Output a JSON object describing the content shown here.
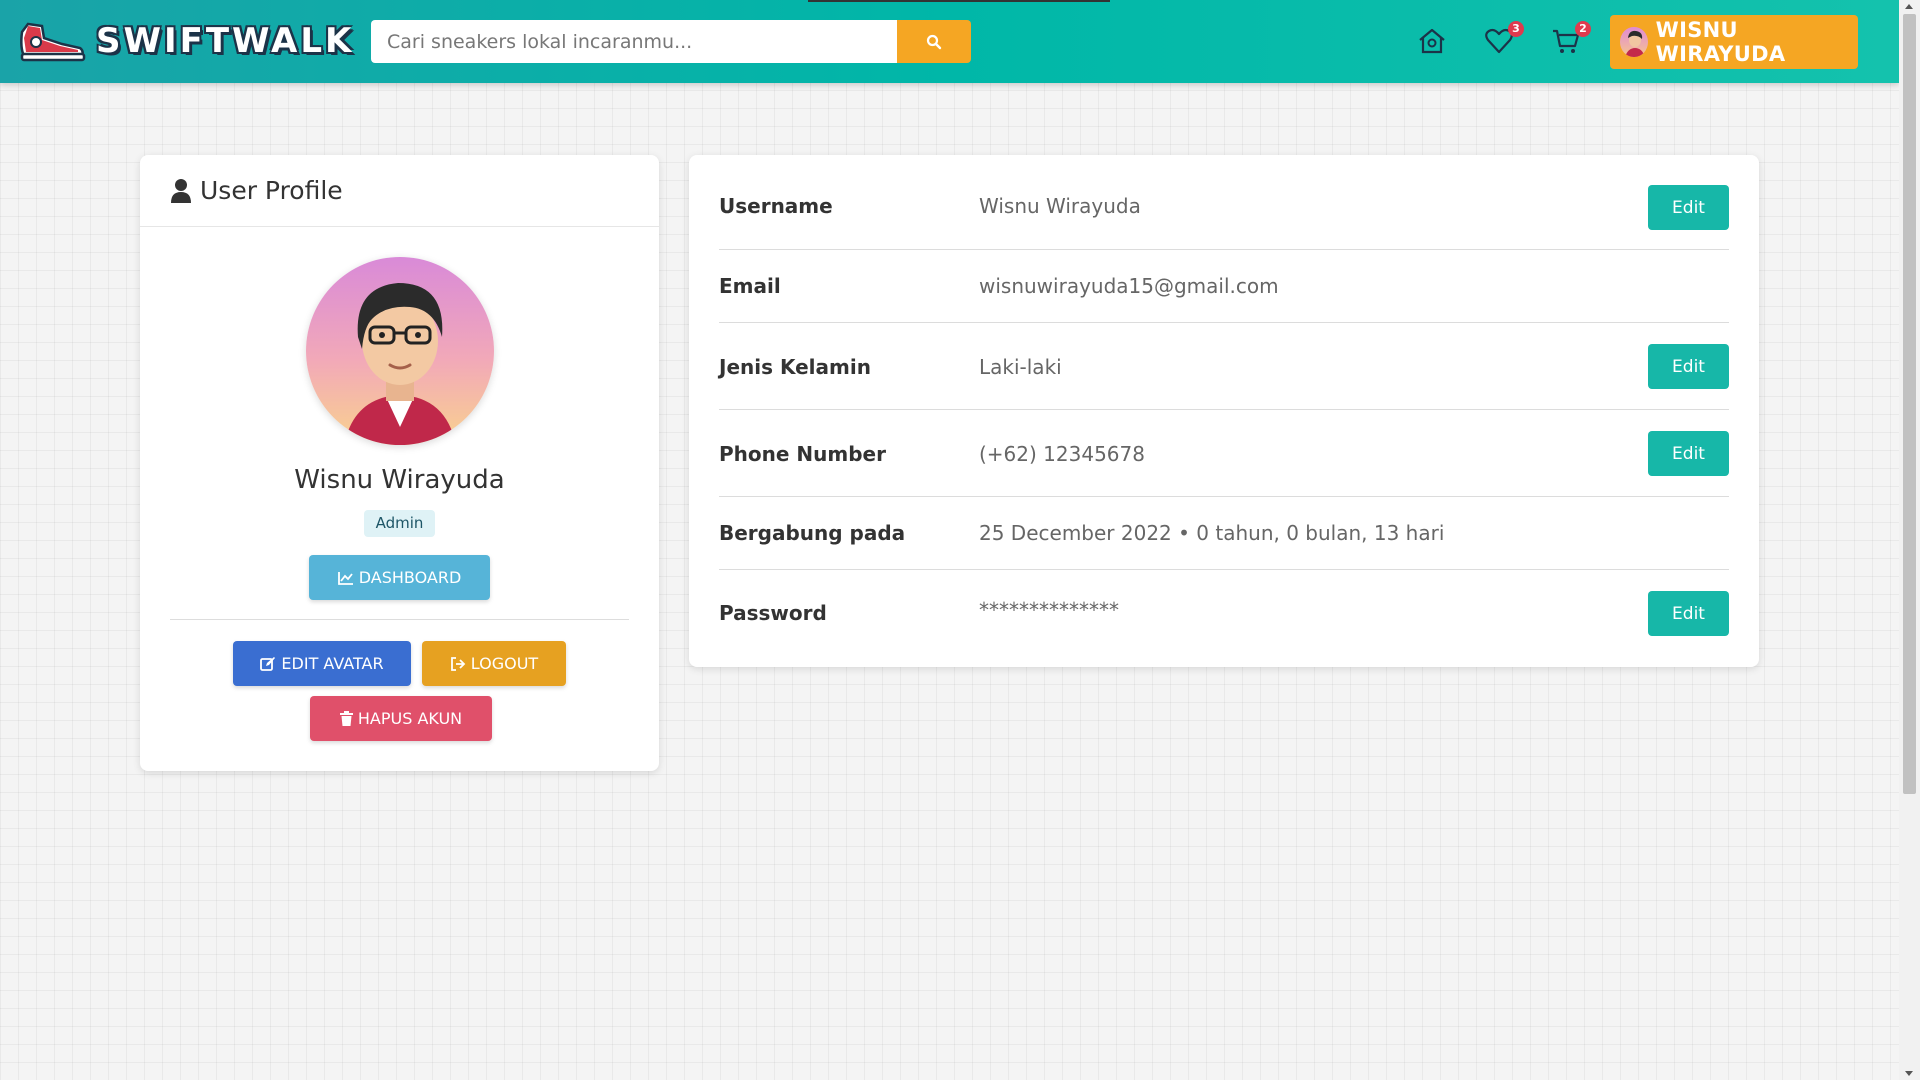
{
  "header": {
    "brand": "SWIFTWALK",
    "search": {
      "placeholder": "Cari sneakers lokal incaranmu...",
      "value": ""
    },
    "icons": {
      "home": "home-icon",
      "wishlist": {
        "icon": "heart-icon",
        "count": "3"
      },
      "cart": {
        "icon": "cart-icon",
        "count": "2"
      }
    },
    "user_button": "WISNU WIRAYUDA"
  },
  "profile": {
    "card_title": "User Profile",
    "name": "Wisnu Wirayuda",
    "role": "Admin",
    "buttons": {
      "dashboard": "DASHBOARD",
      "edit_avatar": "EDIT AVATAR",
      "logout": "LOGOUT",
      "delete_account": "HAPUS AKUN"
    }
  },
  "info": {
    "rows": [
      {
        "label": "Username",
        "value": "Wisnu Wirayuda",
        "edit": "Edit"
      },
      {
        "label": "Email",
        "value": "wisnuwirayuda15@gmail.com"
      },
      {
        "label": "Jenis Kelamin",
        "value": "Laki-laki",
        "edit": "Edit"
      },
      {
        "label": "Phone Number",
        "value": "(+62) 12345678",
        "edit": "Edit"
      },
      {
        "label": "Bergabung pada",
        "value": "25 December 2022 • 0 tahun, 0 bulan, 13 hari"
      },
      {
        "label": "Password",
        "value": "**************",
        "edit": "Edit"
      }
    ]
  },
  "colors": {
    "primary_teal": "#17b7a8",
    "accent_orange": "#f5a623",
    "info_blue": "#56b4d8",
    "primary_blue": "#3a6ed1",
    "danger_red": "#e0506a"
  }
}
